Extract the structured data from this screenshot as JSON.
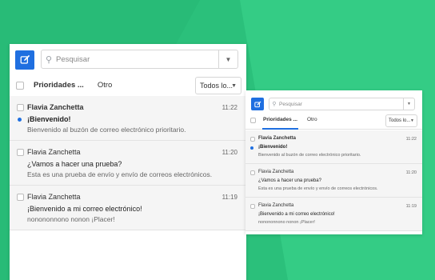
{
  "search": {
    "placeholder": "Pesquisar"
  },
  "tabs": {
    "priority": "Prioridades ...",
    "other": "Otro"
  },
  "filter": {
    "label": "Todos lo..."
  },
  "colors": {
    "accent": "#1f6fe0",
    "background": "#2bc07b",
    "unread_dot": "#1f6fe0"
  },
  "emails": [
    {
      "from": "Flavia Zanchetta",
      "time": "11:22",
      "subject": "¡Bienvenido!",
      "preview": "Bienvenido al buzón de correo electrónico prioritario.",
      "unread": true
    },
    {
      "from": "Flavia Zanchetta",
      "time": "11:20",
      "subject": "¿Vamos a hacer una prueba?",
      "preview": "Esta es una prueba de envío y envío de correos electrónicos.",
      "unread": false
    },
    {
      "from": "Flavia Zanchetta",
      "time": "11:19",
      "subject": "¡Bienvenido a mi correo electrónico!",
      "preview": "nonononnono nonon ¡Placer!",
      "unread": false
    }
  ]
}
